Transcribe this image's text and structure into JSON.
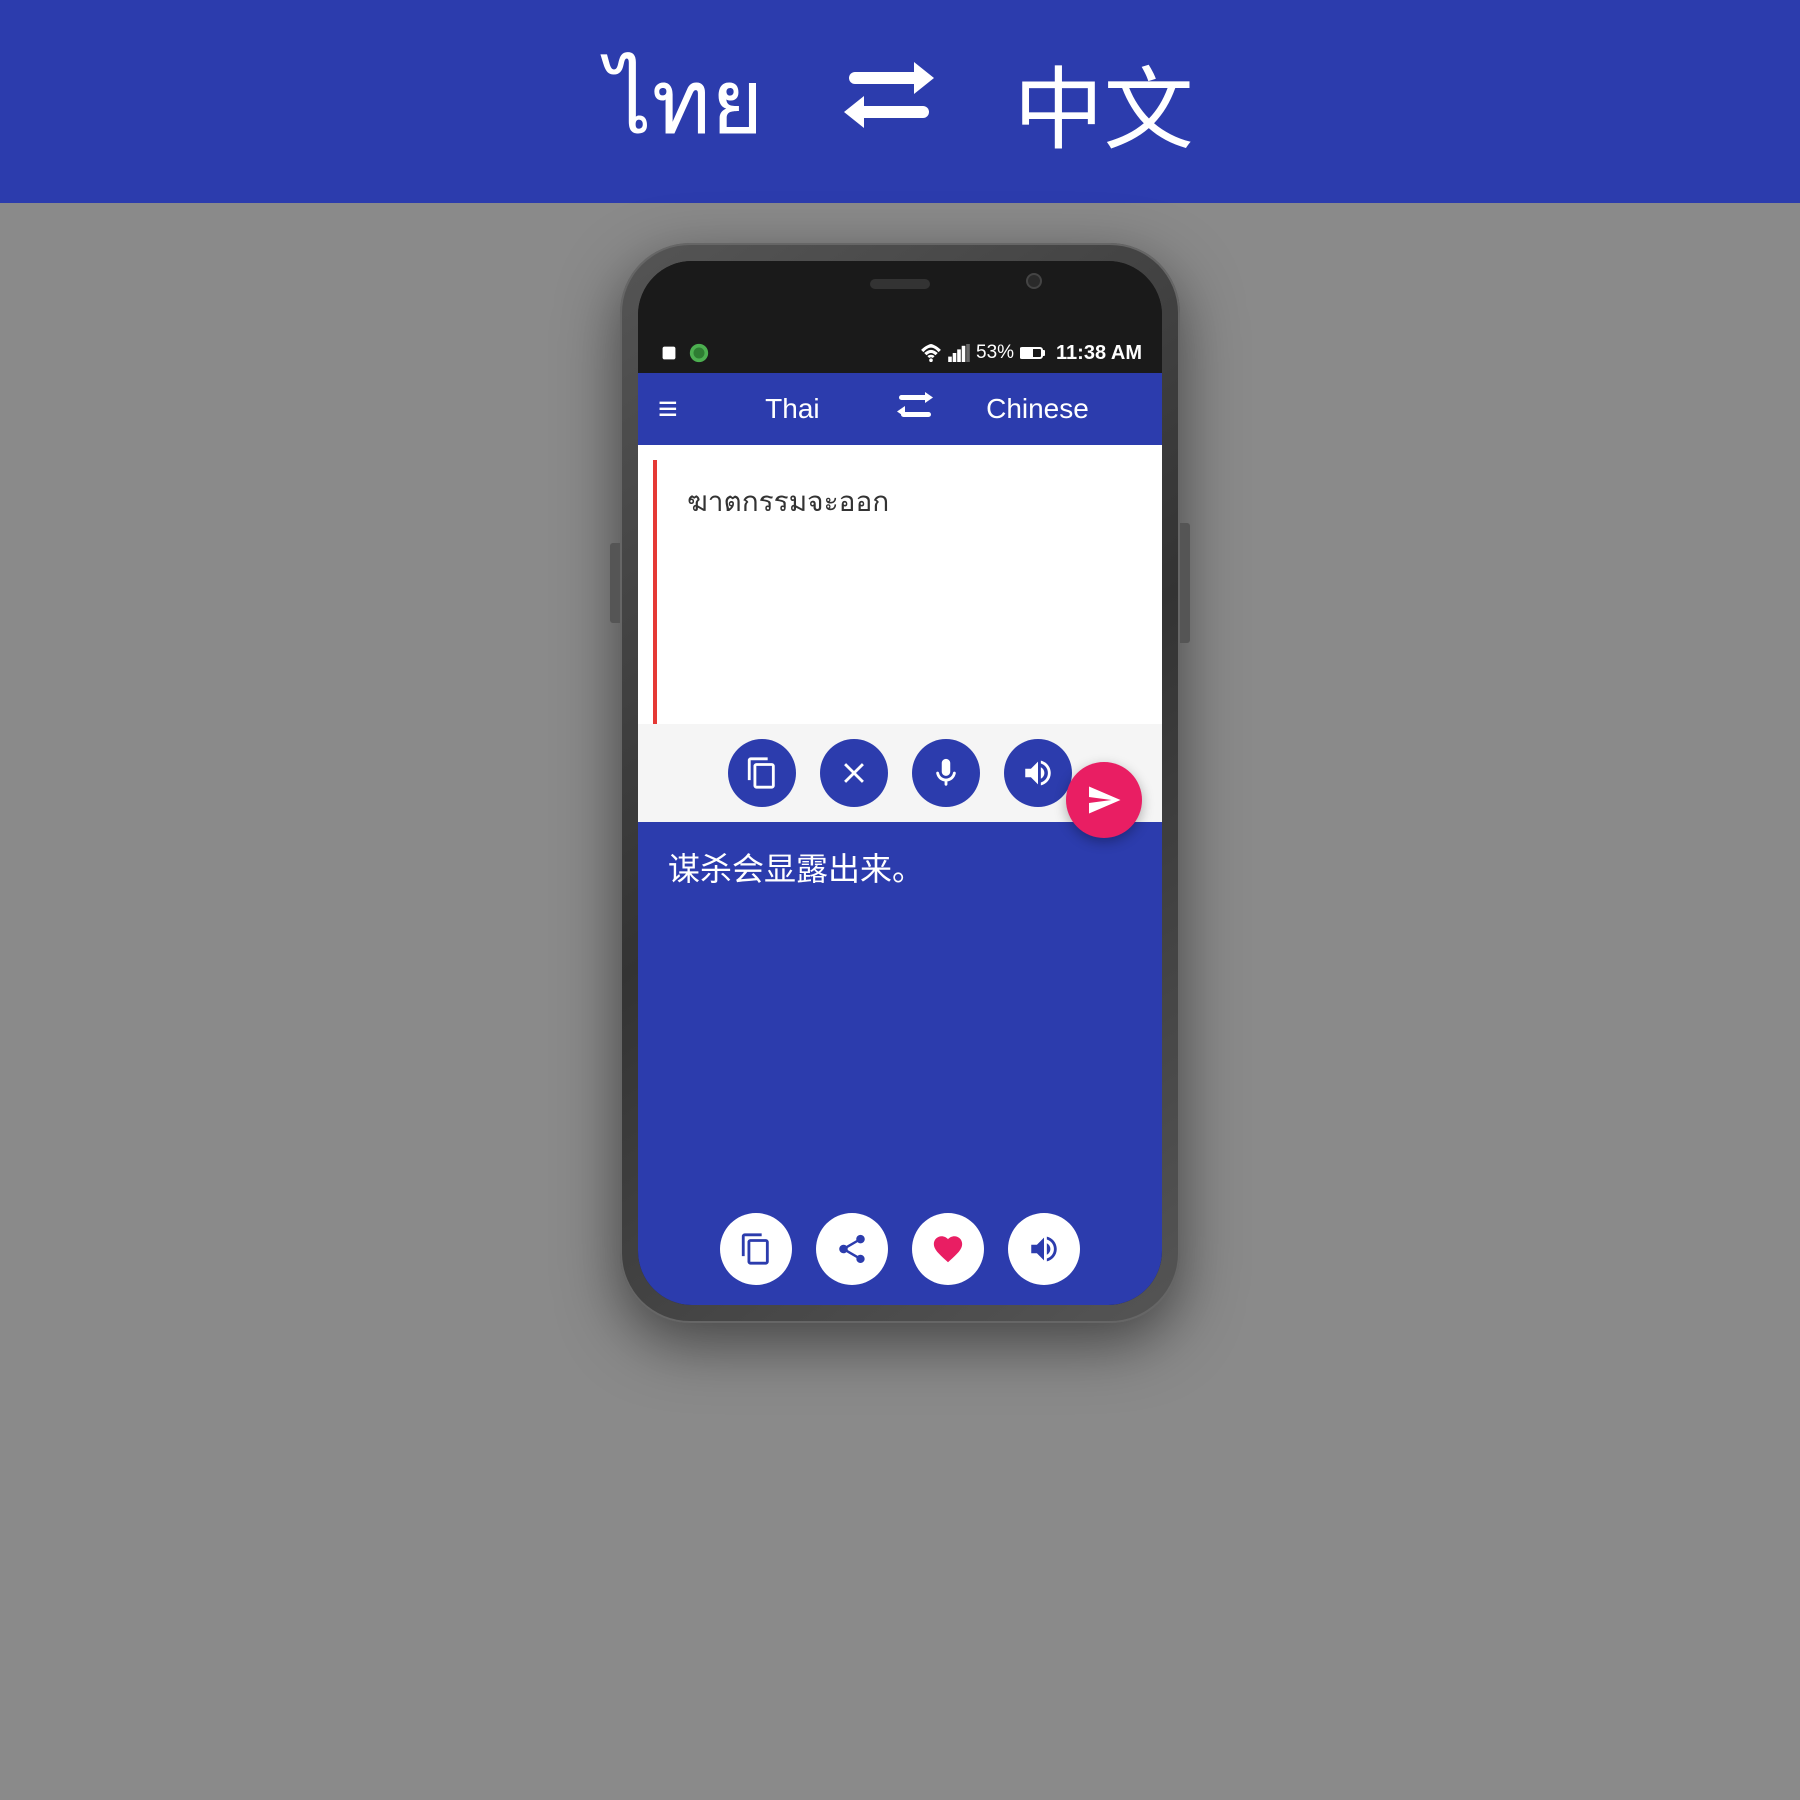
{
  "banner": {
    "lang_left": "ไทย",
    "lang_right": "中文",
    "swap_symbol": "⇄"
  },
  "status_bar": {
    "battery": "53%",
    "time": "11:38 AM"
  },
  "app_header": {
    "lang_left": "Thai",
    "lang_right": "Chinese",
    "hamburger": "≡"
  },
  "input": {
    "text": "ฆาตกรรมจะออก"
  },
  "output": {
    "text": "谋杀会显露出来。"
  },
  "buttons": {
    "clipboard_label": "clipboard",
    "clear_label": "clear",
    "mic_label": "microphone",
    "speaker_label": "speaker",
    "send_label": "send",
    "copy_label": "copy",
    "share_label": "share",
    "heart_label": "favorite",
    "speaker2_label": "speaker"
  },
  "colors": {
    "blue": "#2c3cad",
    "pink": "#e91e63",
    "white": "#ffffff"
  }
}
